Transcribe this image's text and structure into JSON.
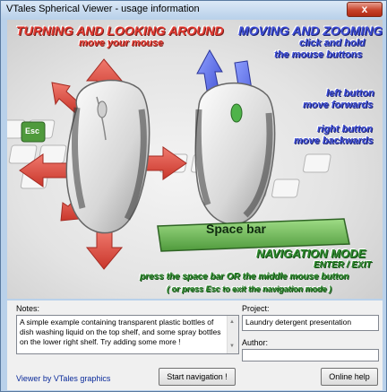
{
  "window": {
    "title": "VTales Spherical Viewer - usage information",
    "close_label": "x"
  },
  "illustration": {
    "turning_heading": "TURNING AND LOOKING AROUND",
    "turning_sub": "move your mouse",
    "moving_heading": "MOVING AND ZOOMING",
    "moving_sub1": "click and hold",
    "moving_sub2": "the mouse buttons",
    "left_button_1": "left button",
    "left_button_2": "move forwards",
    "right_button_1": "right button",
    "right_button_2": "move backwards",
    "esc_key": "Esc",
    "space_bar": "Space bar",
    "nav_mode_heading": "NAVIGATION MODE",
    "nav_enter_exit": "ENTER / EXIT",
    "nav_instructions": "press the space bar OR the middle mouse button",
    "nav_esc_note": "( or press Esc to exit the navigation mode )"
  },
  "bottom": {
    "notes_label": "Notes:",
    "notes_text": "A simple example containing transparent plastic bottles of dish washing liquid on the top shelf, and some spray bottles on the lower right shelf. Try adding some more !",
    "project_label": "Project:",
    "project_value": "Laundry detergent presentation",
    "author_label": "Author:",
    "author_value": "",
    "viewer_link": "Viewer by VTales graphics",
    "start_button": "Start navigation !",
    "help_button": "Online help"
  },
  "colors": {
    "red_text": "#e23b32",
    "blue_text": "#3f4fd6",
    "green_text": "#2f8a2f",
    "space_bar": "#6fb85a"
  },
  "icons": [
    "close-icon",
    "mouse-icon",
    "arrow-icon",
    "keyboard-icon",
    "scroll-up-icon",
    "scroll-down-icon"
  ]
}
